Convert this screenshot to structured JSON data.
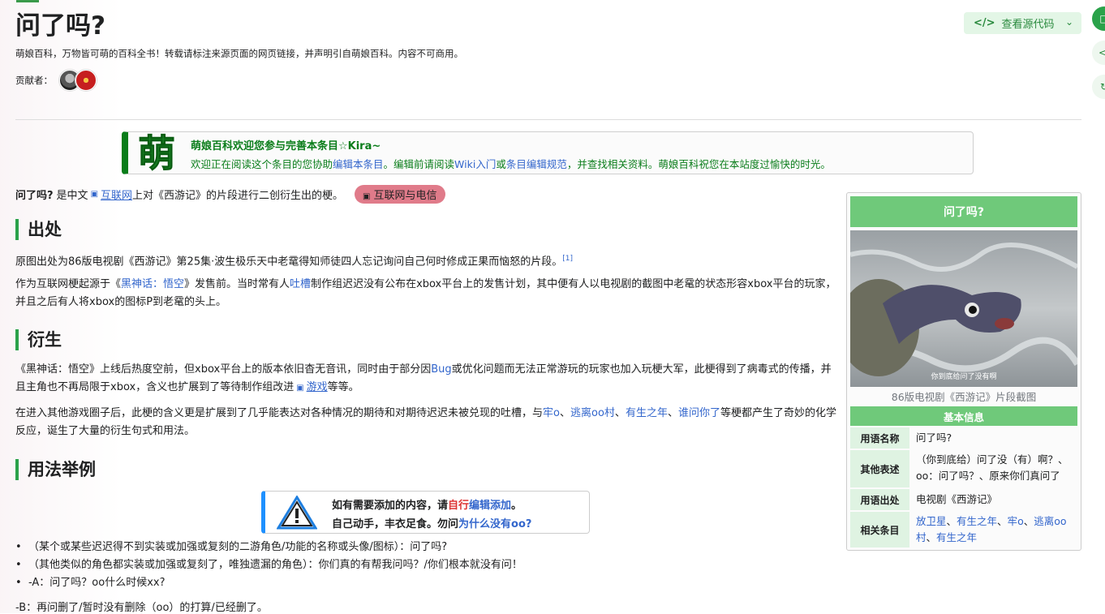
{
  "page": {
    "title": "问了吗?",
    "subtitle": "萌娘百科，万物皆可萌的百科全书！转载请标注来源页面的网页链接，并声明引自萌娘百科。内容不可商用。",
    "contributors_label": "贡献者：",
    "view_source_label": "查看源代码"
  },
  "welcome": {
    "moe_char": "萌",
    "line1": "萌娘百科欢迎您参与完善本条目☆Kira~",
    "line2_a": "欢迎正在阅读这个条目的您协助",
    "line2_link1": "编辑本条目",
    "line2_b": "。编辑前请阅读",
    "line2_link2": "Wiki入门",
    "line2_c": "或",
    "line2_link3": "条目编辑规范",
    "line2_d": "，并查找相关资料。萌娘百科祝您在本站度过愉快的时光。"
  },
  "intro": {
    "bold": "问了吗?",
    "a": "是中文",
    "link": "互联网",
    "b": "上对《西游记》的片段进行二创衍生出的梗。",
    "tag": "互联网与电信"
  },
  "sections": {
    "origin": "出处",
    "derivation": "衍生",
    "usage": "用法举例"
  },
  "origin": {
    "p1": "原图出处为86版电视剧《西游记》第25集·波生极乐天中老鼋得知师徒四人忘记询问自己何时修成正果而恼怒的片段。",
    "ref": "[1]",
    "p2_a": "作为互联网梗起源于《",
    "p2_link1": "黑神话：悟空",
    "p2_b": "》发售前。当时常有人",
    "p2_link2": "吐槽",
    "p2_c": "制作组迟迟没有公布在xbox平台上的发售计划，其中便有人以电视剧的截图中老鼋的状态形容xbox平台的玩家，并且之后有人将xbox的图标P到老鼋的头上。"
  },
  "derivation": {
    "p1_a": "《黑神话：悟空》上线后热度空前，但xbox平台上的版本依旧杳无音讯，同时由于部分因",
    "p1_link1": "Bug",
    "p1_b": "或优化问题而无法正常游玩的玩家也加入玩梗大军，此梗得到了病毒式的传播，并且主角也不再局限于xbox，含义也扩展到了等待制作组改进",
    "p1_link2": "游戏",
    "p1_c": "等等。",
    "p2_a": "在进入其他游戏圈子后，此梗的含义更是扩展到了几乎能表达对各种情况的期待和对期待迟迟未被兑现的吐槽，与",
    "p2_l1": "牢o",
    "p2_s1": "、",
    "p2_l2": "逃离oo村",
    "p2_s2": "、",
    "p2_l3": "有生之年",
    "p2_s3": "、",
    "p2_l4": "谁问你了",
    "p2_b": "等梗都产生了奇妙的化学反应，诞生了大量的衍生句式和用法。"
  },
  "notice": {
    "n1_a": "如有需要添加的内容，请",
    "n1_red": "自行",
    "n1_link": "编辑添加",
    "n1_b": "。",
    "n2_a": "自己动手，丰衣足食。勿问",
    "n2_link": "为什么没有oo?"
  },
  "usage": {
    "items": [
      "（某个或某些迟迟得不到实装或加强或复刻的二游角色/功能的名称或头像/图标）：问了吗?",
      "（其他类似的角色都实装或加强或复刻了，唯独遗漏的角色）：你们真的有帮我问吗？/你们根本就没有问！",
      "-A：问了吗？oo什么时候xx?"
    ],
    "last": "-B：再问删了/暂时没有删除（oo）的打算/已经删了。"
  },
  "infobox": {
    "title": "问了吗?",
    "image_subtitle": "你到底给问了没有啊",
    "caption": "86版电视剧《西游记》片段截图",
    "section": "基本信息",
    "rows": [
      {
        "k": "用语名称",
        "v": "问了吗?"
      },
      {
        "k": "其他表述",
        "v": "（你到底给）问了没（有）啊？、oo：问了吗？、原来你们真问了"
      },
      {
        "k": "用语出处",
        "v": "电视剧《西游记》"
      },
      {
        "k": "相关条目",
        "v": ""
      }
    ],
    "related": [
      "放卫星",
      "有生之年",
      "牢o",
      "逃离oo村",
      "有生之年"
    ]
  }
}
